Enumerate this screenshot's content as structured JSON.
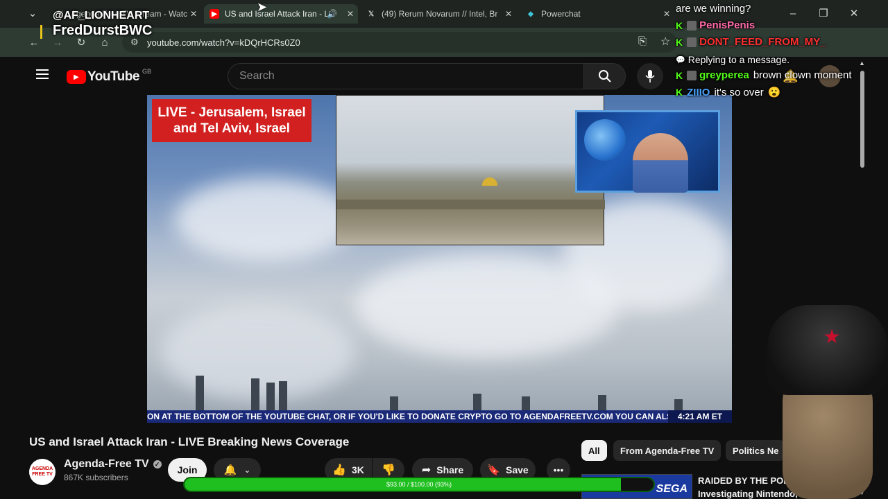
{
  "browser": {
    "tabs": [
      {
        "label": "Agenda-Free TV Stream - Watc",
        "icon": "x-icon"
      },
      {
        "label": "US and Israel Attack Iran - L",
        "icon": "youtube-icon",
        "active": true
      },
      {
        "label": "(49) Rerum Novarum // Intel, Br",
        "icon": "x-icon"
      },
      {
        "label": "Powerchat",
        "icon": "powerchat-icon"
      }
    ],
    "url": "youtube.com/watch?v=kDQrHCRs0Z0"
  },
  "overlay": {
    "handle": "@AF_LIONHEART",
    "name": "FredDurstBWC"
  },
  "youtube": {
    "logo_text": "YouTube",
    "region": "GB",
    "search_placeholder": "Search"
  },
  "video": {
    "live_banner_line1": "LIVE - Jerusalem, Israel",
    "live_banner_line2": "and Tel Aviv, Israel",
    "ticker_text": "ON AT THE BOTTOM OF THE YOUTUBE CHAT, OR IF YOU'D LIKE TO DONATE CRYPTO GO TO AGENDAFREETV.COM     YOU CAN ALSO",
    "ticker_time": "4:21 AM ET",
    "title": "US and Israel Attack Iran - LIVE Breaking News Coverage"
  },
  "channel": {
    "name": "Agenda-Free TV",
    "subscribers": "867K subscribers",
    "join_label": "Join",
    "avatar_text": "AGENDA FREE TV"
  },
  "actions": {
    "likes": "3K",
    "share_label": "Share",
    "save_label": "Save"
  },
  "chips": [
    "All",
    "From Agenda-Free TV",
    "Politics Ne"
  ],
  "recommended": {
    "title_line1": "RAIDED BY THE POL",
    "title_line2": "Investigating Nintendo,",
    "thumb_text": "SEGA"
  },
  "donation": {
    "text": "$93.00 / $100.00 (93%)",
    "fraction": 0.93
  },
  "chat": [
    {
      "user": "",
      "text": "are we winning?"
    },
    {
      "user": "PenisPenis",
      "text": "",
      "user_color": "#ff6aa9"
    },
    {
      "user": "DONT_FEED_FROM_MY_",
      "text": "",
      "user_color": "#ff3030"
    },
    {
      "user": "",
      "text": "Replying to a message."
    },
    {
      "user": "greyperea",
      "text": "brown clown moment",
      "user_color": "#53fc18"
    },
    {
      "user": "ZIIIO",
      "text": "it's so over",
      "user_color": "#4aa3ff"
    }
  ],
  "colors": {
    "youtube_red": "#ff0000",
    "live_red": "#d21f1f",
    "progress_green": "#1fbf1f",
    "kick_green": "#53fc18"
  }
}
